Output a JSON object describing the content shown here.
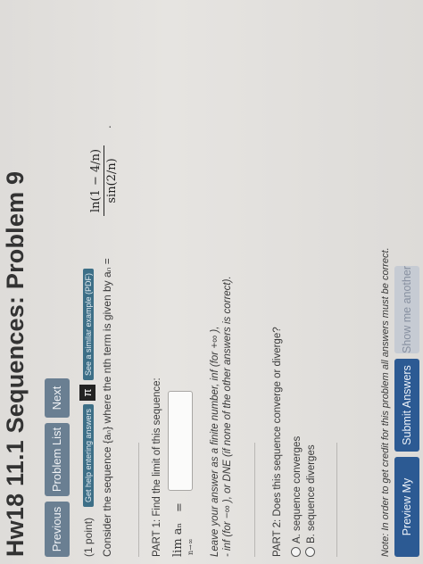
{
  "title": "Hw18 11.1 Sequences: Problem 9",
  "nav": {
    "previous": "Previous",
    "problem_list": "Problem List",
    "next": "Next"
  },
  "problem": {
    "points": "(1 point)",
    "help_link": "Get help entering answers",
    "pi_icon": "π",
    "example_link": "See a similar example (PDF)",
    "consider_text": "Consider the sequence {aₙ} where the nth term is given by  aₙ =",
    "formula_numerator": "ln(1 − 4/n)",
    "formula_denominator": "sin(2/n)",
    "formula_end": "."
  },
  "part1": {
    "heading": "PART 1: Find the limit of this sequence:",
    "lim": "lim aₙ",
    "lim_sub": "n→∞",
    "equals": "=",
    "answer_value": "",
    "instructions_1": "Leave your answer as a finite number,  inf  (for +∞ ),",
    "instructions_2": "- inf  (for −∞ ), or DNE  (if none of the other answers is correct)."
  },
  "part2": {
    "heading": "PART 2: Does this sequence converge or diverge?",
    "option_a": "A. sequence converges",
    "option_b": "B. sequence diverges"
  },
  "note": "Note: In order to get credit for this problem all answers must be correct.",
  "buttons": {
    "preview": "Preview My Answers",
    "submit": "Submit Answers",
    "show_another": "Show me another"
  },
  "colors": {
    "nav_button": "#6a7f92",
    "submit_button": "#2c5a93",
    "badge": "#3d6f87"
  }
}
